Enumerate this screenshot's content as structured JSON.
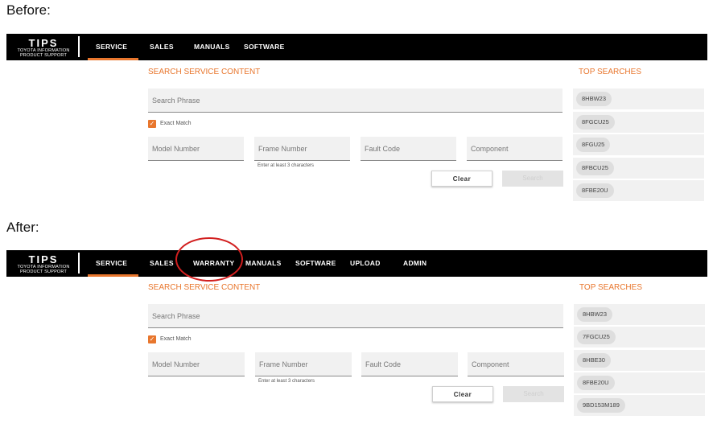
{
  "captions": {
    "before": "Before:",
    "after": "After:"
  },
  "logo": {
    "title": "TIPS",
    "line1": "TOYOTA INFORMATION",
    "line2": "PRODUCT SUPPORT"
  },
  "before": {
    "nav": [
      "SERVICE",
      "SALES",
      "MANUALS",
      "SOFTWARE"
    ],
    "active_tab": "SERVICE",
    "search_heading": "SEARCH SERVICE CONTENT",
    "search_placeholder": "Search Phrase",
    "exact_match": "Exact Match",
    "fields": [
      "Model Number",
      "Frame Number",
      "Fault Code",
      "Component"
    ],
    "frame_hint": "Enter at least 3 characters",
    "clear": "Clear",
    "search": "Search",
    "top_heading": "TOP SEARCHES",
    "top_searches": [
      "8HBW23",
      "8FGCU25",
      "8FGU25",
      "8FBCU25",
      "8FBE20U"
    ]
  },
  "after": {
    "nav": [
      "SERVICE",
      "SALES",
      "WARRANTY",
      "MANUALS",
      "SOFTWARE",
      "UPLOAD",
      "ADMIN"
    ],
    "active_tab": "SERVICE",
    "search_heading": "SEARCH SERVICE CONTENT",
    "search_placeholder": "Search Phrase",
    "exact_match": "Exact Match",
    "fields": [
      "Model Number",
      "Frame Number",
      "Fault Code",
      "Component"
    ],
    "frame_hint": "Enter at least 3 characters",
    "clear": "Clear",
    "search": "Search",
    "top_heading": "TOP SEARCHES",
    "top_searches": [
      "8HBW23",
      "7FGCU25",
      "8HBE30",
      "8FBE20U",
      "9BD153M189"
    ]
  },
  "colors": {
    "accent": "#e8762d",
    "nav_bg": "#000000",
    "highlight": "#d21f1f"
  },
  "icons": {
    "checkbox": "check-icon"
  }
}
